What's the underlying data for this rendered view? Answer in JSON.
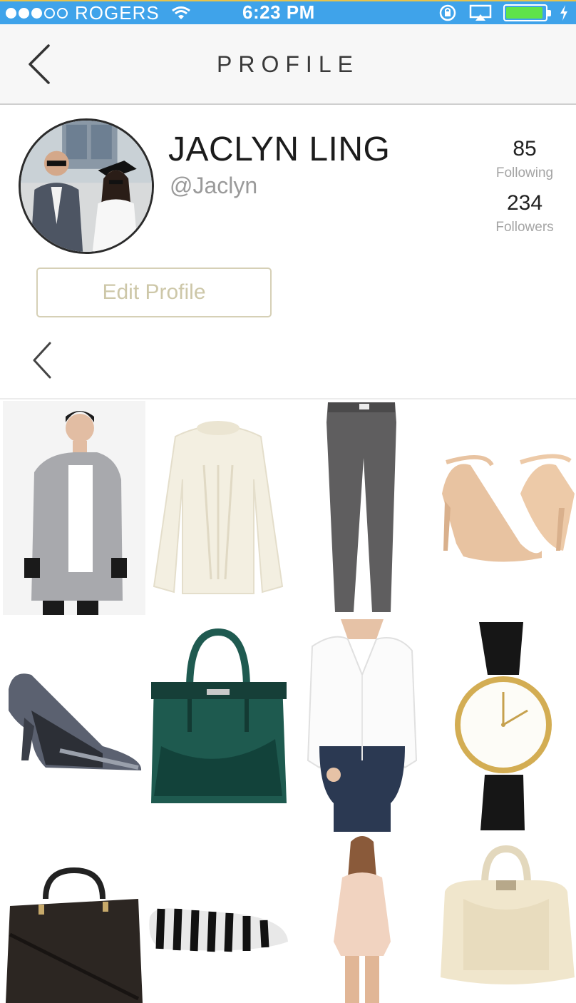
{
  "status_bar": {
    "carrier": "ROGERS",
    "time": "6:23 PM",
    "signal_dots_filled": 3,
    "signal_dots_total": 5,
    "battery_level": 0.95
  },
  "nav": {
    "title": "PROFILE",
    "back_icon": "chevron-left-icon"
  },
  "profile": {
    "name": "JACLYN LING",
    "handle": "@Jaclyn",
    "stats": {
      "following_count": "85",
      "following_label": "Following",
      "followers_count": "234",
      "followers_label": "Followers"
    },
    "edit_button_label": "Edit Profile"
  },
  "grid_items": [
    {
      "name": "grey-coat"
    },
    {
      "name": "cream-sweater"
    },
    {
      "name": "grey-jeans"
    },
    {
      "name": "nude-heels"
    },
    {
      "name": "grey-pumps"
    },
    {
      "name": "green-handbag"
    },
    {
      "name": "white-blouse"
    },
    {
      "name": "gold-watch"
    },
    {
      "name": "black-handbag"
    },
    {
      "name": "striped-loafers"
    },
    {
      "name": "blush-romper"
    },
    {
      "name": "cream-satchel"
    }
  ],
  "colors": {
    "status_bar": "#3fa3ea",
    "nav_bar": "#f7f7f7",
    "edit_button_border": "#d6d0b6",
    "edit_button_text": "#cdc7a8"
  }
}
